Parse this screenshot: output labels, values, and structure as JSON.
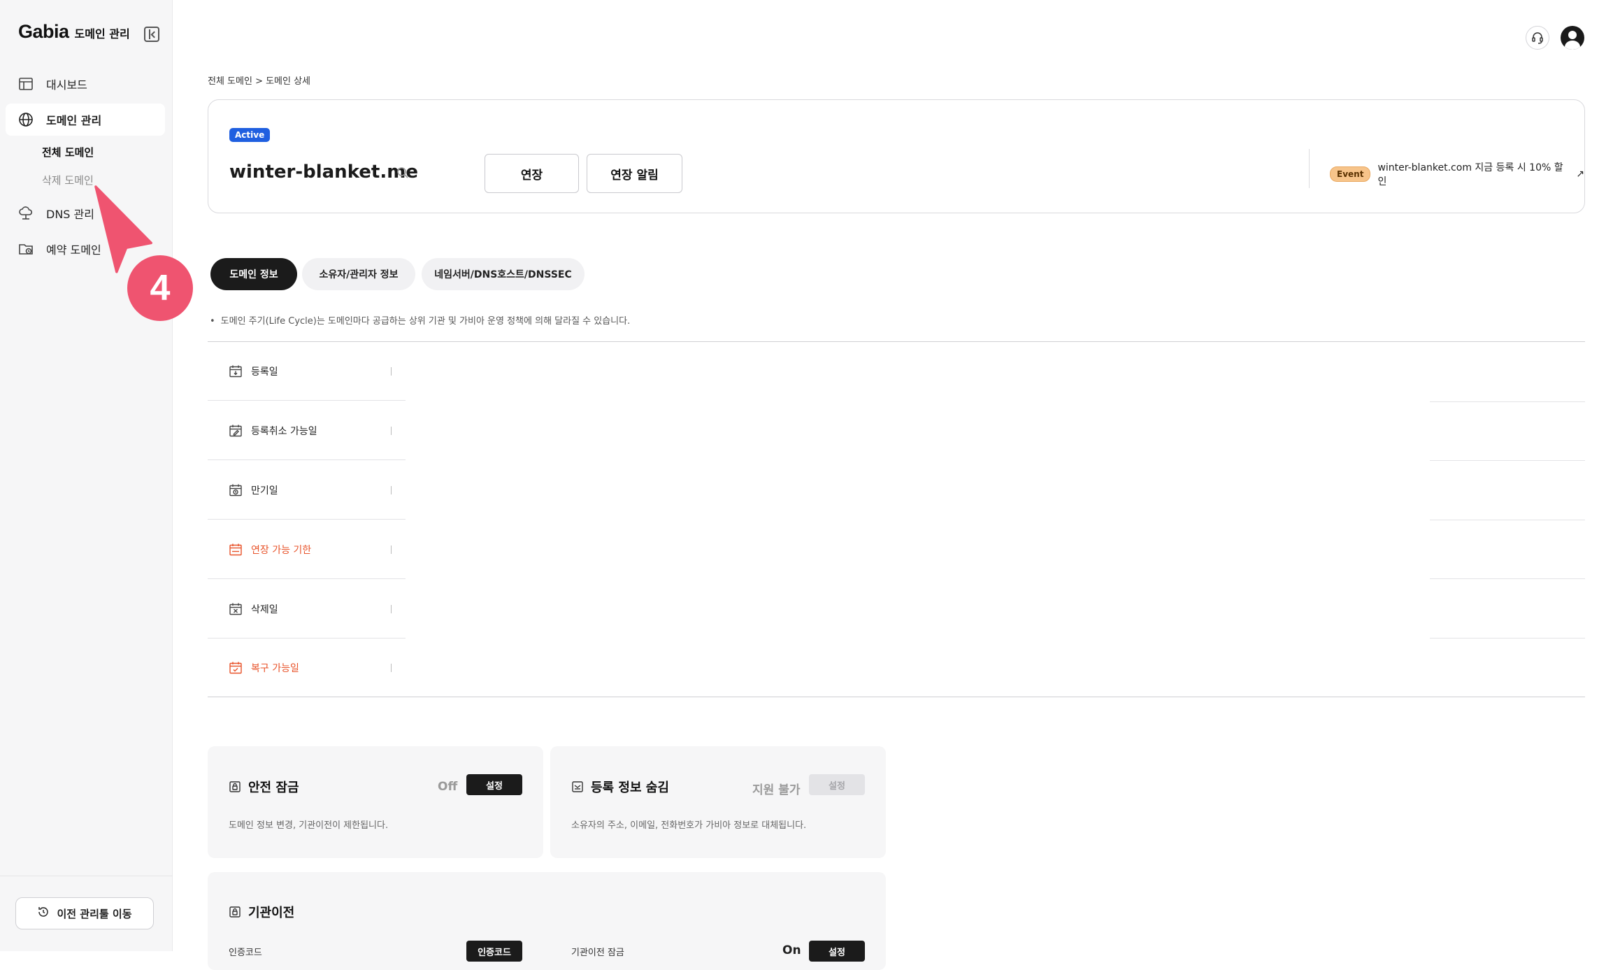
{
  "brand": {
    "logo": "Gabia",
    "title": "도메인 관리"
  },
  "sidebar": {
    "items": [
      {
        "label": "대시보드"
      },
      {
        "label": "도메인 관리"
      },
      {
        "label": "DNS 관리"
      },
      {
        "label": "예약 도메인"
      }
    ],
    "sub_items": [
      {
        "label": "전체 도메인"
      },
      {
        "label": "삭제 도메인"
      }
    ],
    "legacy_button": "이전 관리툴 이동"
  },
  "breadcrumb": "전체 도메인 > 도메인 상세",
  "domain": {
    "status": "Active",
    "name": "winter-blanket.me",
    "renew_button": "연장",
    "renew_alert_button": "연장 알림",
    "event_badge": "Event",
    "event_text": "winter-blanket.com 지금 등록 시 10% 할인",
    "event_arrow": "↗"
  },
  "tabs": [
    {
      "label": "도메인 정보"
    },
    {
      "label": "소유자/관리자 정보"
    },
    {
      "label": "네임서버/DNS호스트/DNSSEC"
    }
  ],
  "notice": "도메인 주기(Life Cycle)는 도메인마다 공급하는 상위 기관 및 가비아 운영 정책에 의해 달라질 수 있습니다.",
  "lifecycle": [
    {
      "label": "등록일",
      "warn": false
    },
    {
      "label": "등록취소 가능일",
      "warn": false
    },
    {
      "label": "만기일",
      "warn": false
    },
    {
      "label": "연장 가능 기한",
      "warn": true
    },
    {
      "label": "삭제일",
      "warn": false
    },
    {
      "label": "복구 가능일",
      "warn": true
    }
  ],
  "panels": {
    "safe_lock": {
      "title": "안전 잠금",
      "status": "Off",
      "button": "설정",
      "desc": "도메인 정보 변경, 기관이전이 제한됩니다."
    },
    "privacy": {
      "title": "등록 정보 숨김",
      "status": "지원 불가",
      "button": "설정",
      "desc": "소유자의 주소, 이메일, 전화번호가 가비아 정보로 대체됩니다."
    },
    "transfer": {
      "title": "기관이전",
      "auth_code_label": "인증코드",
      "auth_code_button": "인증코드",
      "transfer_lock_label": "기관이전 잠금",
      "transfer_lock_status": "On",
      "transfer_lock_button": "설정"
    }
  },
  "tutorial_step": "4",
  "colors": {
    "accent": "#1f5fe0",
    "warn": "#e8532a",
    "step": "#ef5470",
    "dark": "#1b1b1b"
  }
}
